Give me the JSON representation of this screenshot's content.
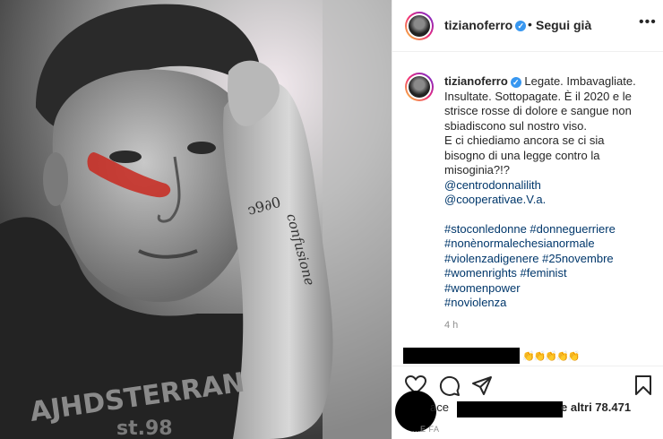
{
  "post_image": {
    "tattoo_text": "confusione",
    "shirt_text": "AJHDSTERRAN",
    "shirt_number": "st.98"
  },
  "header": {
    "username": "tizianoferro",
    "separator": "•",
    "follow_label": "Segui già",
    "more_icon": "more-horizontal-icon"
  },
  "caption": {
    "username": "tizianoferro",
    "text_lines": [
      "Legate. Imbavagliate.",
      "Insultate. Sottopagate. È il 2020 e le",
      "strisce rosse di dolore e sangue non",
      "sbiadiscono sul nostro viso.",
      "E ci chiediamo ancora se ci sia",
      "bisogno di una legge contro la",
      "misoginia?!?"
    ],
    "mentions": [
      "@centrodonnalilith",
      "@cooperativae.V.a."
    ],
    "hashtags": [
      "#stoconledonne #donneguerriere",
      "#nonènormalechesianormale",
      "#violenzadigenere #25novembre",
      "#womenrights #feminist",
      "#womenpower",
      "#noviolenza"
    ],
    "time_ago": "4 h"
  },
  "actions": {
    "like": "heart-icon",
    "comment": "comment-icon",
    "share": "share-icon",
    "save": "bookmark-icon"
  },
  "likes": {
    "prefix": "ace",
    "suffix": "e altri 78.471"
  },
  "post_date": "...E FA",
  "colors": {
    "link": "#00376b",
    "verified": "#3897f0",
    "muted": "#8e8e8e"
  }
}
